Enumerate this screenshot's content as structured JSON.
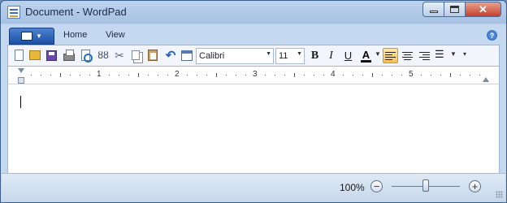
{
  "window": {
    "title": "Document - WordPad",
    "icon": "wordpad-icon",
    "controls": {
      "minimize": "minimize-icon",
      "maximize": "maximize-icon",
      "close": "✕"
    }
  },
  "ribbon": {
    "app_menu_icon": "app-menu-icon",
    "tabs": [
      {
        "label": "Home"
      },
      {
        "label": "View"
      }
    ],
    "help": "?"
  },
  "toolbar": {
    "font_family": "Calibri",
    "font_size": "11",
    "bold": "B",
    "italic": "I",
    "underline": "U",
    "font_color": "A",
    "align_active": "left",
    "accent_color": "#f5c257"
  },
  "ruler": {
    "numbers": [
      "1",
      "2",
      "3",
      "4",
      "5"
    ]
  },
  "status": {
    "zoom": "100%",
    "zoom_out": "−",
    "zoom_in": "+",
    "zoom_level": 1.0
  }
}
